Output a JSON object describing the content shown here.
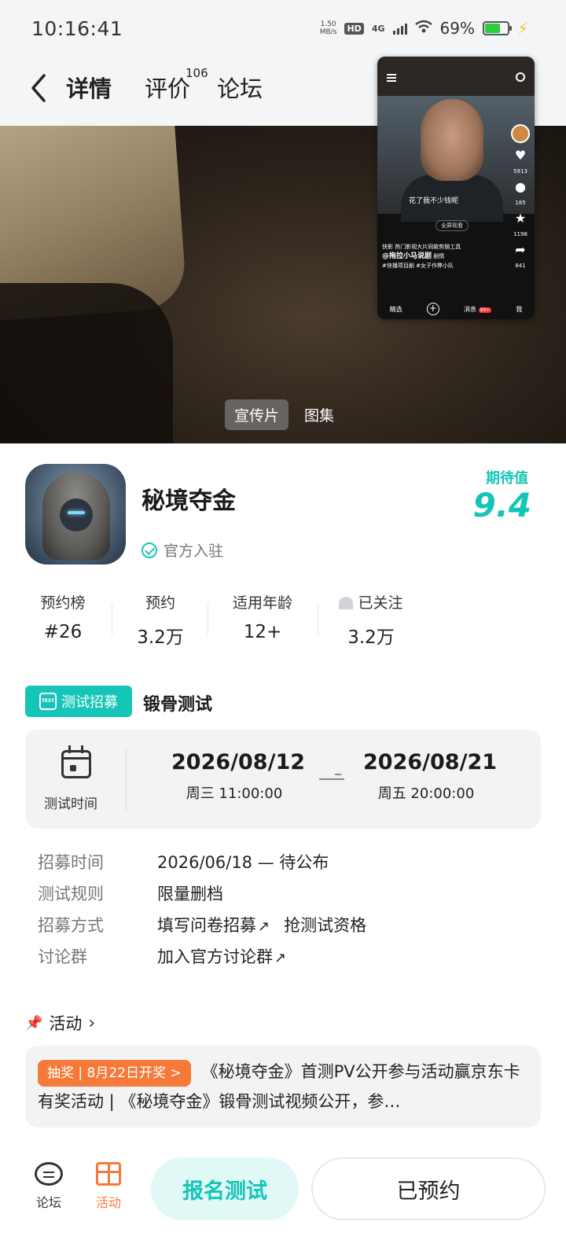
{
  "status_bar": {
    "time": "10:16:41",
    "speed_value": "1.50",
    "speed_unit": "MB/s",
    "hd": "HD",
    "network": "4G",
    "battery": "69%",
    "battery_level": 0.69
  },
  "header": {
    "tabs": [
      "详情",
      "评价",
      "论坛"
    ],
    "review_count": "106",
    "accent_color": "#15c6b8"
  },
  "hero": {
    "tabs": [
      "宣传片",
      "图集"
    ]
  },
  "floating_preview": {
    "subtitle": "花了我不少钱呢",
    "fullscreen": "全屏观看",
    "likes": "5913",
    "comments": "185",
    "favorites": "1198",
    "shares": "841",
    "caption_line1": "快影  热门影视大片同款剪辑工具",
    "user": "@拖拉小马说剧",
    "tag_plot": "剧情",
    "hashtags": "#快播项目剧 #女子作弊小队",
    "nav": [
      "精选",
      "+",
      "消息",
      "我"
    ],
    "msg_badge": "99+"
  },
  "app": {
    "name": "秘境夺金",
    "official": "官方入驻",
    "expect_label": "期待值",
    "expect_value": "9.4"
  },
  "stats": [
    {
      "label": "预约榜",
      "value": "#26"
    },
    {
      "label": "预约",
      "value": "3.2万"
    },
    {
      "label": "适用年龄",
      "value": "12+"
    },
    {
      "label": "已关注",
      "value": "3.2万"
    }
  ],
  "recruit": {
    "badge": "测试招募",
    "badge_icon_text": "TEST",
    "name": "锻骨测试",
    "time_label": "测试时间",
    "start_date": "2026/08/12",
    "start_day": "周三  11:00:00",
    "end_date": "2026/08/21",
    "end_day": "周五  20:00:00",
    "rows": [
      {
        "key": "招募时间",
        "value": "2026/06/18 — 待公布"
      },
      {
        "key": "测试规则",
        "value": "限量删档"
      },
      {
        "key": "招募方式",
        "link": "填写问卷招募",
        "extra": "抢测试资格"
      },
      {
        "key": "讨论群",
        "link": "加入官方讨论群"
      }
    ]
  },
  "activity": {
    "title": "活动",
    "lottery": "抽奖 | 8月22日开奖 >",
    "text": "《秘境夺金》首测PV公开参与活动赢京东卡 有奖活动 | 《秘境夺金》锻骨测试视频公开，参…"
  },
  "bottom_bar": {
    "forum": "论坛",
    "activity": "活动",
    "signup": "报名测试",
    "reserved": "已预约",
    "activity_color": "#f57a3a"
  }
}
